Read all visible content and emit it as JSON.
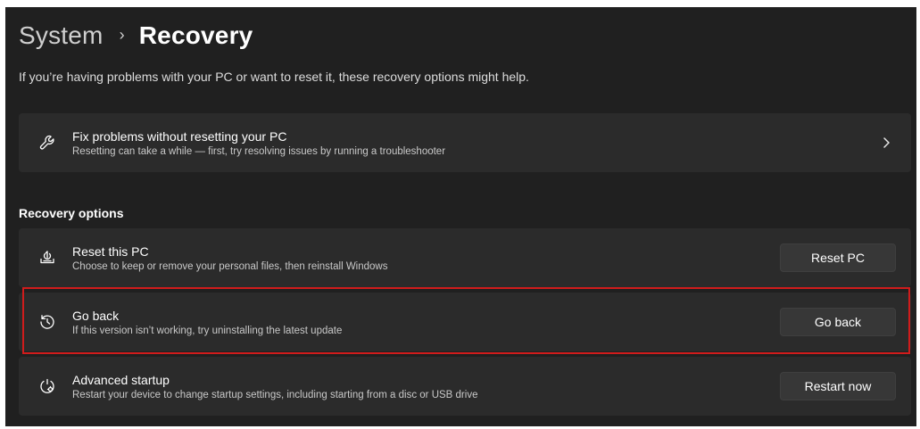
{
  "breadcrumb": {
    "parent": "System",
    "separator": "›",
    "current": "Recovery"
  },
  "subtitle": "If you’re having problems with your PC or want to reset it, these recovery options might help.",
  "fix_card": {
    "title": "Fix problems without resetting your PC",
    "description": "Resetting can take a while — first, try resolving issues by running a troubleshooter",
    "icon": "wrench-icon",
    "chevron": "›"
  },
  "recovery_section": {
    "label": "Recovery options",
    "items": [
      {
        "title": "Reset this PC",
        "description": "Choose to keep or remove your personal files, then reinstall Windows",
        "button": "Reset PC",
        "icon": "reset-pc-icon"
      },
      {
        "title": "Go back",
        "description": "If this version isn’t working, try uninstalling the latest update",
        "button": "Go back",
        "icon": "history-icon"
      },
      {
        "title": "Advanced startup",
        "description": "Restart your device to change startup settings, including starting from a disc or USB drive",
        "button": "Restart now",
        "icon": "advanced-startup-icon"
      }
    ]
  },
  "colors": {
    "background": "#202020",
    "card": "#2b2b2b",
    "button": "#373737",
    "highlight": "#d01c1c"
  }
}
